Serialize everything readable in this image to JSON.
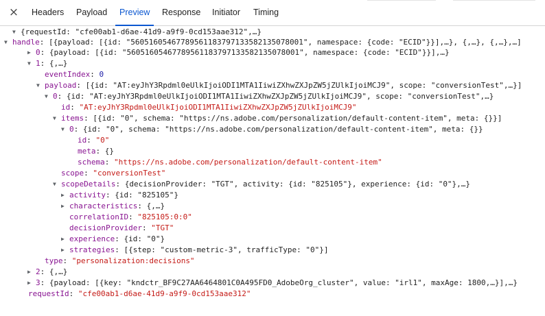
{
  "tabs": {
    "close_icon": "×",
    "items": [
      {
        "label": "Headers"
      },
      {
        "label": "Payload"
      },
      {
        "label": "Preview"
      },
      {
        "label": "Response"
      },
      {
        "label": "Initiator"
      },
      {
        "label": "Timing"
      }
    ],
    "active_color": "#0b57d0"
  },
  "tree": {
    "r0": {
      "value": "{requestId: \"cfe00ab1-d6ae-41d9-a9f9-0cd153aae312\",…}"
    },
    "r1": {
      "key": "handle",
      "value": "[{payload: [{id: \"56051605467789561183797133582135078001\", namespace: {code: \"ECID\"}}],…}, {,…}, {,…},…]"
    },
    "r2": {
      "key": "0",
      "value": "{payload: [{id: \"56051605467789561183797133582135078001\", namespace: {code: \"ECID\"}}],…}"
    },
    "r3": {
      "key": "1",
      "value": "{,…}"
    },
    "r4": {
      "key": "eventIndex",
      "value": "0"
    },
    "r5": {
      "key": "payload",
      "value": "[{id: \"AT:eyJhY3Rpdml0eUlkIjoiODI1MTA1IiwiZXhwZXJpZW5jZUlkIjoiMCJ9\", scope: \"conversionTest\",…}]"
    },
    "r6": {
      "key": "0",
      "value": "{id: \"AT:eyJhY3Rpdml0eUlkIjoiODI1MTA1IiwiZXhwZXJpZW5jZUlkIjoiMCJ9\", scope: \"conversionTest\",…}"
    },
    "r7": {
      "key": "id",
      "value": "\"AT:eyJhY3Rpdml0eUlkIjoiODI1MTA1IiwiZXhwZXJpZW5jZUlkIjoiMCJ9\""
    },
    "r8": {
      "key": "items",
      "value": "[{id: \"0\", schema: \"https://ns.adobe.com/personalization/default-content-item\", meta: {}}]"
    },
    "r9": {
      "key": "0",
      "value": "{id: \"0\", schema: \"https://ns.adobe.com/personalization/default-content-item\", meta: {}}"
    },
    "r10": {
      "key": "id",
      "value": "\"0\""
    },
    "r11": {
      "key": "meta",
      "value": "{}"
    },
    "r12": {
      "key": "schema",
      "value": "\"https://ns.adobe.com/personalization/default-content-item\""
    },
    "r13": {
      "key": "scope",
      "value": "\"conversionTest\""
    },
    "r14": {
      "key": "scopeDetails",
      "value": "{decisionProvider: \"TGT\", activity: {id: \"825105\"}, experience: {id: \"0\"},…}"
    },
    "r15": {
      "key": "activity",
      "value": "{id: \"825105\"}"
    },
    "r16": {
      "key": "characteristics",
      "value": "{,…}"
    },
    "r17": {
      "key": "correlationID",
      "value": "\"825105:0:0\""
    },
    "r18": {
      "key": "decisionProvider",
      "value": "\"TGT\""
    },
    "r19": {
      "key": "experience",
      "value": "{id: \"0\"}"
    },
    "r20": {
      "key": "strategies",
      "value": "[{step: \"custom-metric-3\", trafficType: \"0\"}]"
    },
    "r21": {
      "key": "type",
      "value": "\"personalization:decisions\""
    },
    "r22": {
      "key": "2",
      "value": "{,…}"
    },
    "r23": {
      "key": "3",
      "value": "{payload: [{key: \"kndctr_BF9C27AA6464801C0A495FD0_AdobeOrg_cluster\", value: \"irl1\", maxAge: 1800,…}],…}"
    },
    "r24": {
      "key": "requestId",
      "value": "\"cfe00ab1-d6ae-41d9-a9f9-0cd153aae312\""
    }
  },
  "colors": {
    "key": "#881391",
    "string": "#c41a16",
    "number": "#1a1aa6"
  }
}
